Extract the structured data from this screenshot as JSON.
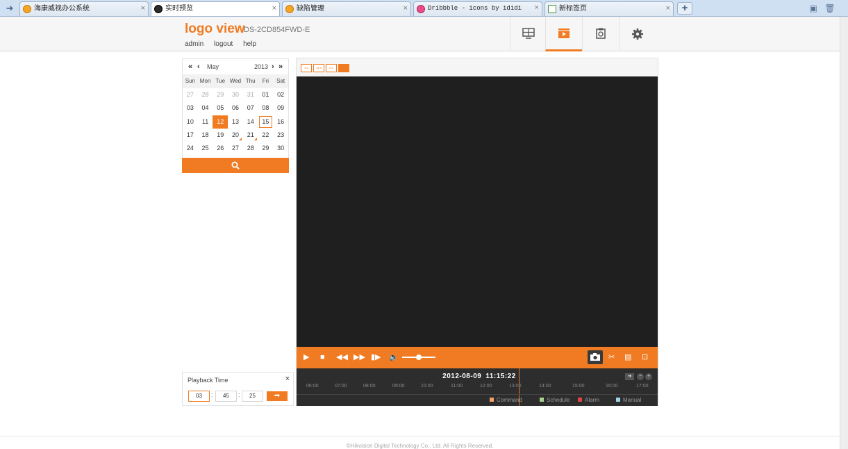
{
  "browser": {
    "tabs": [
      {
        "label": "海康威视办公系统",
        "favicon": "orange"
      },
      {
        "label": "实时预览",
        "favicon": "dark"
      },
      {
        "label": "缺陷管理",
        "favicon": "orange"
      },
      {
        "label": "Dribbble - icons by ididi",
        "favicon": "pink"
      },
      {
        "label": "新标签页",
        "favicon": "page"
      }
    ],
    "new_tab_label": "+"
  },
  "header": {
    "logo": "logo view",
    "model": "DS-2CD854FWD-E",
    "links": [
      "admin",
      "logout",
      "help"
    ],
    "menu": [
      {
        "icon": "monitor-icon",
        "active": false
      },
      {
        "icon": "playback-icon",
        "active": true
      },
      {
        "icon": "clipboard-icon",
        "active": false
      },
      {
        "icon": "gear-icon",
        "active": false
      }
    ]
  },
  "calendar": {
    "month": "May",
    "year": "2013",
    "weekdays": [
      "Sun",
      "Mon",
      "Tue",
      "Wed",
      "Thu",
      "Fri",
      "Sat"
    ],
    "days": [
      {
        "d": "27",
        "t": "other"
      },
      {
        "d": "28",
        "t": "other"
      },
      {
        "d": "29",
        "t": "other"
      },
      {
        "d": "30",
        "t": "other"
      },
      {
        "d": "31",
        "t": "other"
      },
      {
        "d": "01",
        "t": ""
      },
      {
        "d": "02",
        "t": ""
      },
      {
        "d": "03",
        "t": ""
      },
      {
        "d": "04",
        "t": ""
      },
      {
        "d": "05",
        "t": ""
      },
      {
        "d": "06",
        "t": ""
      },
      {
        "d": "07",
        "t": ""
      },
      {
        "d": "08",
        "t": ""
      },
      {
        "d": "09",
        "t": ""
      },
      {
        "d": "10",
        "t": ""
      },
      {
        "d": "11",
        "t": ""
      },
      {
        "d": "12",
        "t": "sel"
      },
      {
        "d": "13",
        "t": ""
      },
      {
        "d": "14",
        "t": ""
      },
      {
        "d": "15",
        "t": "today"
      },
      {
        "d": "16",
        "t": ""
      },
      {
        "d": "17",
        "t": ""
      },
      {
        "d": "18",
        "t": ""
      },
      {
        "d": "19",
        "t": ""
      },
      {
        "d": "20",
        "t": "rec"
      },
      {
        "d": "21",
        "t": "rec"
      },
      {
        "d": "22",
        "t": ""
      },
      {
        "d": "23",
        "t": ""
      },
      {
        "d": "24",
        "t": ""
      },
      {
        "d": "25",
        "t": ""
      },
      {
        "d": "26",
        "t": ""
      },
      {
        "d": "27",
        "t": ""
      },
      {
        "d": "28",
        "t": ""
      },
      {
        "d": "29",
        "t": ""
      },
      {
        "d": "30",
        "t": ""
      }
    ]
  },
  "playback_time": {
    "title": "Playback Time",
    "close": "×",
    "hour": "03",
    "minute": "45",
    "second": "25",
    "separator": ":"
  },
  "player": {
    "ratios": [
      "4:3",
      "16:9",
      "X:1",
      "fit"
    ],
    "volume": 0.5,
    "timeline": {
      "date": "2012-08-09",
      "time": "11:15:22",
      "ticks": [
        "06:00",
        "07:00",
        "08:00",
        "09:00",
        "10:00",
        "11:00",
        "12:00",
        "13:00",
        "14:00",
        "15:00",
        "16:00",
        "17:00"
      ],
      "legend": [
        {
          "label": "Command",
          "color": "#f5a06a"
        },
        {
          "label": "Schedule",
          "color": "#a9d18e"
        },
        {
          "label": "Alarm",
          "color": "#e04545"
        },
        {
          "label": "Manual",
          "color": "#9fd3e6"
        }
      ]
    }
  },
  "footer": "©Hikvision Digital Technology Co., Ltd. All Rights Reserved.",
  "colors": {
    "accent": "#f07b22",
    "video_bg": "#1f1f1f",
    "timeline_bg": "#2d2d2d"
  }
}
